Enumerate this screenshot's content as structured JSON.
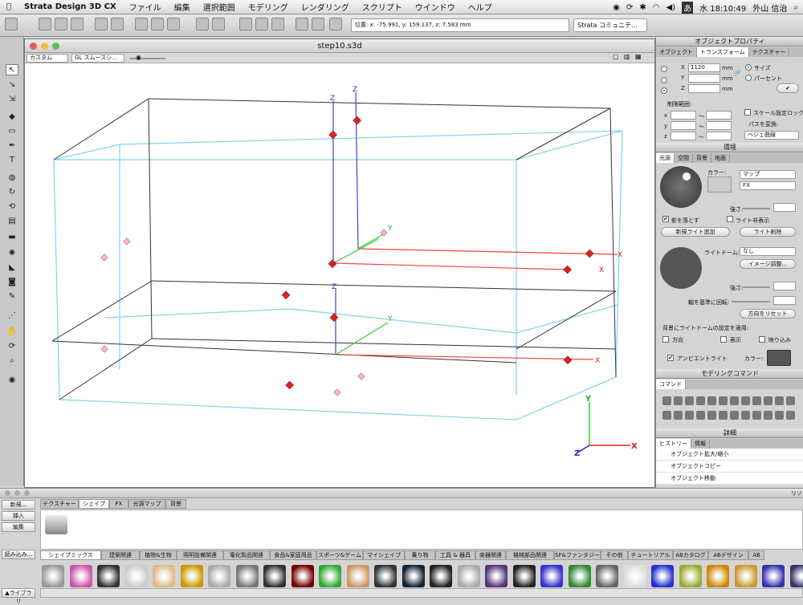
{
  "menubar": {
    "app": "Strata Design 3D CX",
    "items": [
      "ファイル",
      "編集",
      "選択範囲",
      "モデリング",
      "レンダリング",
      "スクリプト",
      "ウインドウ",
      "ヘルプ"
    ],
    "clock": "水 18:10:49",
    "user": "外山 信治",
    "input_mode": "あ"
  },
  "toolbar": {
    "coords": "位置: x: -75.991, y: 159.137, z: 7.583 mm",
    "community": "Strata コミュニテ..."
  },
  "document": {
    "title": "step10.s3d",
    "view_mode": "カスタム",
    "render_mode": "GL スムースシ..."
  },
  "viewport": {
    "axis_labels": {
      "x": "X",
      "y": "Y",
      "z": "Z"
    }
  },
  "object_props": {
    "title": "オブジェクトプロパティ",
    "tabs": [
      "オブジェクト",
      "トランスフォーム",
      "テクスチャー"
    ],
    "x_value": "1120",
    "unit": "mm",
    "size_label": "サイズ",
    "percent_label": "パーセント",
    "limit_label": "制限範囲:",
    "range_sep": "〜",
    "scale_lock": "スケール設定ロック",
    "path_label": "パスを変換:",
    "path_value": "ベジェ曲線",
    "axes": [
      "x",
      "y",
      "z"
    ],
    "field_axes": [
      "X",
      "Y",
      "Z"
    ]
  },
  "environment": {
    "title": "環境",
    "tabs": [
      "光源",
      "空間",
      "背景",
      "地面"
    ],
    "color_label": "カラー:",
    "map_value": "マップ",
    "fx_value": "FX",
    "strength_label": "強さ:",
    "shadow": "影を落とす",
    "light_display": "ライト非表示",
    "new_light": "新規ライト追加",
    "delete_light": "ライト削除",
    "dome_label": "ライトドーム:",
    "dome_value": "なし",
    "image_adjust": "イメージ調整...",
    "rotate_label": "軸を基準に回転:",
    "reset_dir": "方向をリセット",
    "apply_label": "背景にライトドームの設定を適用:",
    "opt_dir": "方向",
    "opt_show": "表示",
    "opt_reflect": "映り込み",
    "ambient": "アンビエントライト",
    "ambient_color_label": "カラー:"
  },
  "modeling": {
    "title": "モデリングコマンド",
    "tab": "コマンド"
  },
  "details": {
    "title": "詳細",
    "tabs": [
      "ヒストリー",
      "情報"
    ],
    "history": [
      "オブジェクト拡大/縮小",
      "オブジェクトコピー",
      "オブジェクト移動"
    ]
  },
  "library": {
    "left_buttons": [
      "新規...",
      "挿入",
      "編集",
      "読み込み...",
      "▲ライブラリ"
    ],
    "top_tabs": [
      "テクスチャー",
      "シェイプ",
      "FX",
      "光源マップ",
      "背景"
    ],
    "categories": [
      "シェイプミックス",
      "建築関連",
      "植物&生物",
      "照明設備関連",
      "電化製品関連",
      "食品&家庭用品",
      "スポーツ&ゲーム",
      "マイシェイプ",
      "乗り物",
      "工具 & 器具",
      "楽器関連",
      "機械部品関連",
      "SF&ファンタジー",
      "その他",
      "チュートリアル",
      "ABカタログ",
      "ABデザイン",
      "AB"
    ],
    "right_label": "リソ"
  }
}
